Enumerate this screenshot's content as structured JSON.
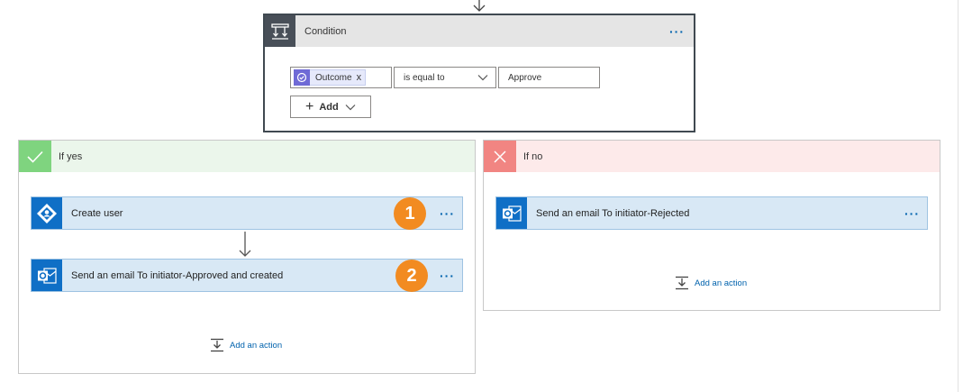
{
  "condition": {
    "title": "Condition",
    "more": "···",
    "token_label": "Outcome",
    "token_remove": "x",
    "operator": "is equal to",
    "value": "Approve",
    "add_label": "Add"
  },
  "branches": {
    "yes": {
      "title": "If yes",
      "actions": [
        {
          "label": "Create user",
          "step": "1",
          "more": "···"
        },
        {
          "label": "Send an email To initiator-Approved and created",
          "step": "2",
          "more": "···"
        }
      ],
      "add_action": "Add an action"
    },
    "no": {
      "title": "If no",
      "actions": [
        {
          "label": "Send an email To initiator-Rejected",
          "more": "···"
        }
      ],
      "add_action": "Add an action"
    }
  },
  "colors": {
    "accent": "#0062ad",
    "condition_header": "#484f58",
    "yes_badge": "#7fd47f",
    "no_badge": "#f18582",
    "step_badge": "#f28b21",
    "action_bg": "#d8e8f5"
  },
  "icons": {
    "condition": "condition-icon",
    "token": "approval-icon",
    "yes": "check-icon",
    "no": "x-icon",
    "create_user": "azure-ad-icon",
    "email": "outlook-icon",
    "add_action": "add-action-icon"
  }
}
